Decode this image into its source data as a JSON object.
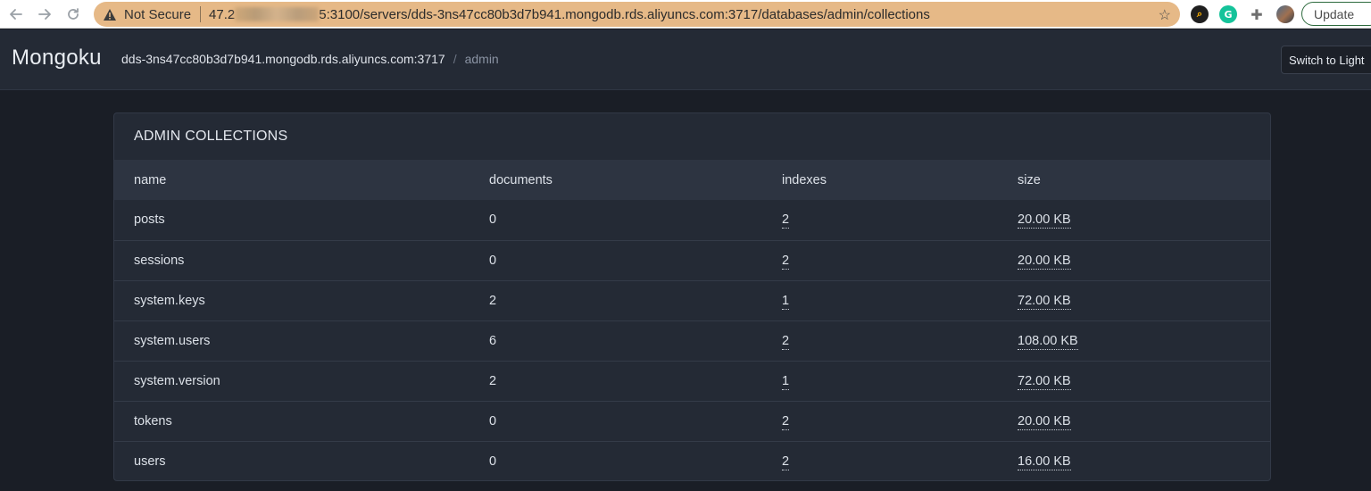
{
  "browser": {
    "security_label": "Not Secure",
    "url_prefix": "47.2",
    "url_rest": "5:3100/servers/dds-3ns47cc80b3d7b941.mongodb.rds.aliyuncs.com:3717/databases/admin/collections",
    "update_label": "Update"
  },
  "app": {
    "brand": "Mongoku",
    "breadcrumb": {
      "server": "dds-3ns47cc80b3d7b941.mongodb.rds.aliyuncs.com:3717",
      "separator": "/",
      "database": "admin"
    },
    "theme_toggle_label": "Switch to Light"
  },
  "panel": {
    "title": "ADMIN COLLECTIONS",
    "columns": [
      "name",
      "documents",
      "indexes",
      "size"
    ],
    "rows": [
      {
        "name": "posts",
        "documents": "0",
        "indexes": "2",
        "size": "20.00 KB"
      },
      {
        "name": "sessions",
        "documents": "0",
        "indexes": "2",
        "size": "20.00 KB"
      },
      {
        "name": "system.keys",
        "documents": "2",
        "indexes": "1",
        "size": "72.00 KB"
      },
      {
        "name": "system.users",
        "documents": "6",
        "indexes": "2",
        "size": "108.00 KB"
      },
      {
        "name": "system.version",
        "documents": "2",
        "indexes": "1",
        "size": "72.00 KB"
      },
      {
        "name": "tokens",
        "documents": "0",
        "indexes": "2",
        "size": "20.00 KB"
      },
      {
        "name": "users",
        "documents": "0",
        "indexes": "2",
        "size": "16.00 KB"
      }
    ]
  },
  "colors": {
    "page_bg": "#1a1e26",
    "navbar_bg": "#242a35",
    "panel_bg": "#242a35",
    "table_header_bg": "#2d3441",
    "omnibox_bg": "#e6b987"
  },
  "icons": [
    "back-arrow-icon",
    "forward-arrow-icon",
    "reload-icon",
    "warning-icon",
    "bookmark-star-icon",
    "search-extension-icon",
    "grammarly-icon",
    "extensions-puzzle-icon",
    "profile-avatar-icon"
  ]
}
